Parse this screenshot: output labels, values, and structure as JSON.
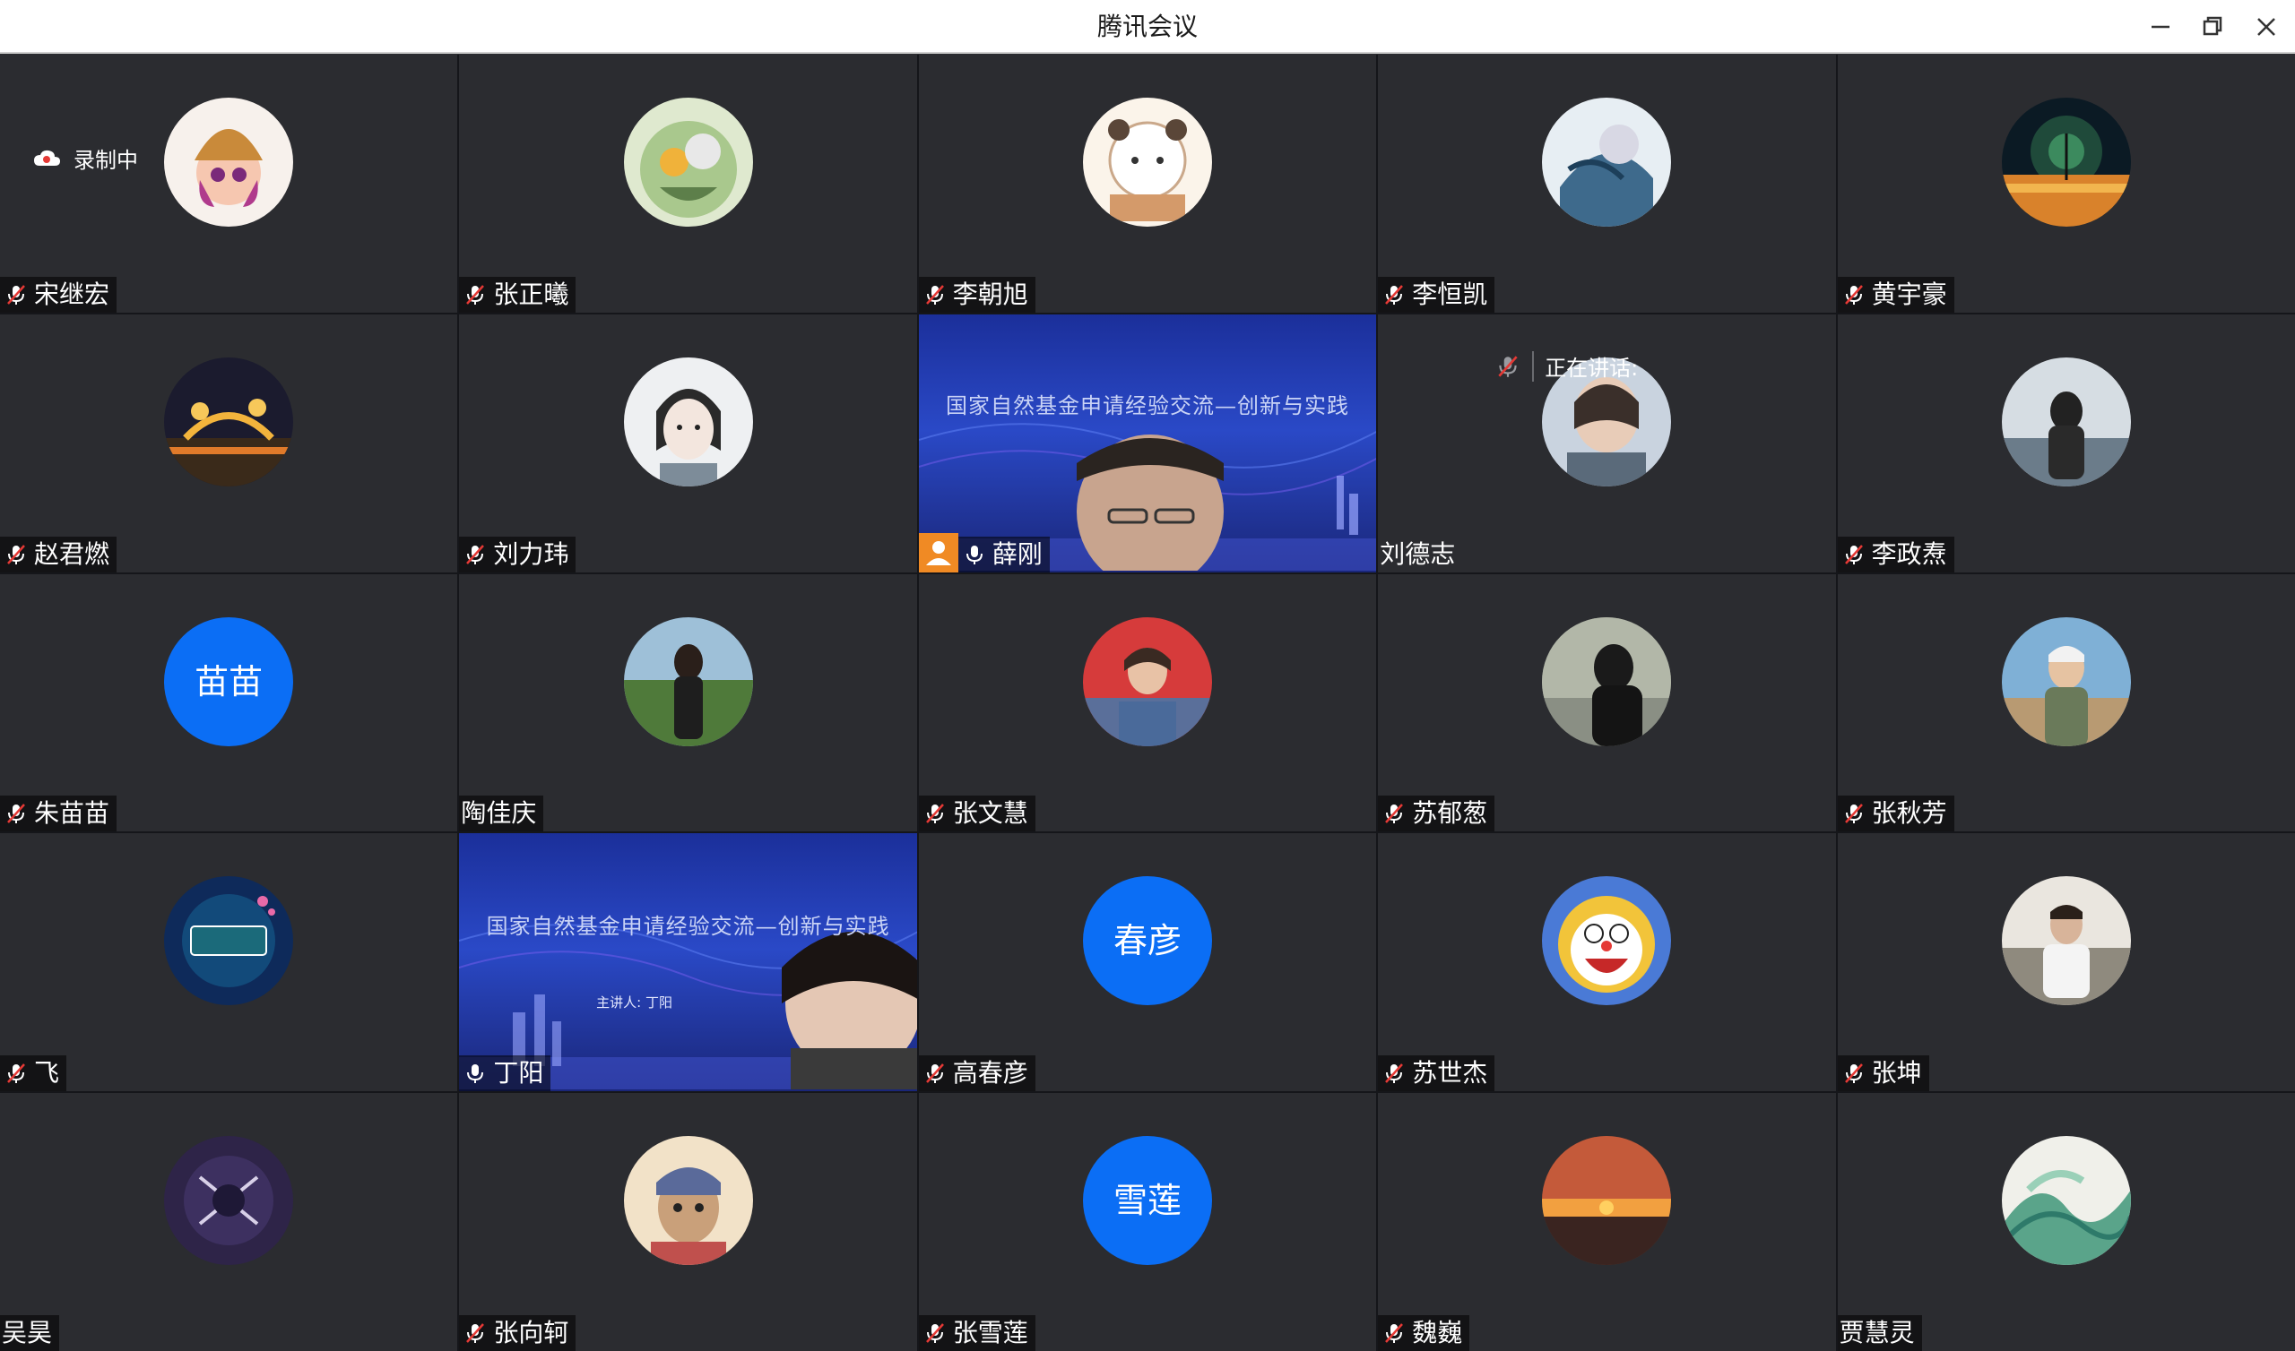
{
  "window": {
    "title": "腾讯会议",
    "controls": [
      "minimize-icon",
      "restore-icon",
      "close-icon"
    ]
  },
  "recording": {
    "label": "录制中"
  },
  "speaking": {
    "label": "正在讲话:"
  },
  "participants": [
    {
      "name": "宋继宏",
      "muted": true
    },
    {
      "name": "张正曦",
      "muted": true
    },
    {
      "name": "李朝旭",
      "muted": true
    },
    {
      "name": "李恒凯",
      "muted": true
    },
    {
      "name": "黄宇豪",
      "muted": true
    },
    {
      "name": "赵君燃",
      "muted": true
    },
    {
      "name": "刘力玮",
      "muted": true
    },
    {
      "name": "薛刚",
      "muted": false,
      "video": true,
      "slide_title": "国家自然基金申请经验交流—创新与实践"
    },
    {
      "name": "刘德志",
      "muted": null
    },
    {
      "name": "李政焘",
      "muted": true
    },
    {
      "name": "朱苗苗",
      "muted": true,
      "avatar_text": "苗苗"
    },
    {
      "name": "陶佳庆",
      "muted": null
    },
    {
      "name": "张文慧",
      "muted": true
    },
    {
      "name": "苏郁葱",
      "muted": true
    },
    {
      "name": "张秋芳",
      "muted": true
    },
    {
      "name": "飞",
      "muted": true
    },
    {
      "name": "丁阳",
      "muted": false,
      "video": true,
      "slide_title": "国家自然基金申请经验交流—创新与实践",
      "slide_subtitle": "主讲人: 丁阳"
    },
    {
      "name": "高春彦",
      "muted": true,
      "avatar_text": "春彦"
    },
    {
      "name": "苏世杰",
      "muted": true
    },
    {
      "name": "张坤",
      "muted": true
    },
    {
      "name": "吴昊",
      "muted": null
    },
    {
      "name": "张向轲",
      "muted": true
    },
    {
      "name": "张雪莲",
      "muted": true,
      "avatar_text": "雪莲"
    },
    {
      "name": "魏巍",
      "muted": true
    },
    {
      "name": "贾慧灵",
      "muted": null
    }
  ],
  "colors": {
    "text_avatar_bg": "#0b6ef5",
    "tile_bg": "#2b2c30",
    "speaker_accent": "#f08a24"
  }
}
